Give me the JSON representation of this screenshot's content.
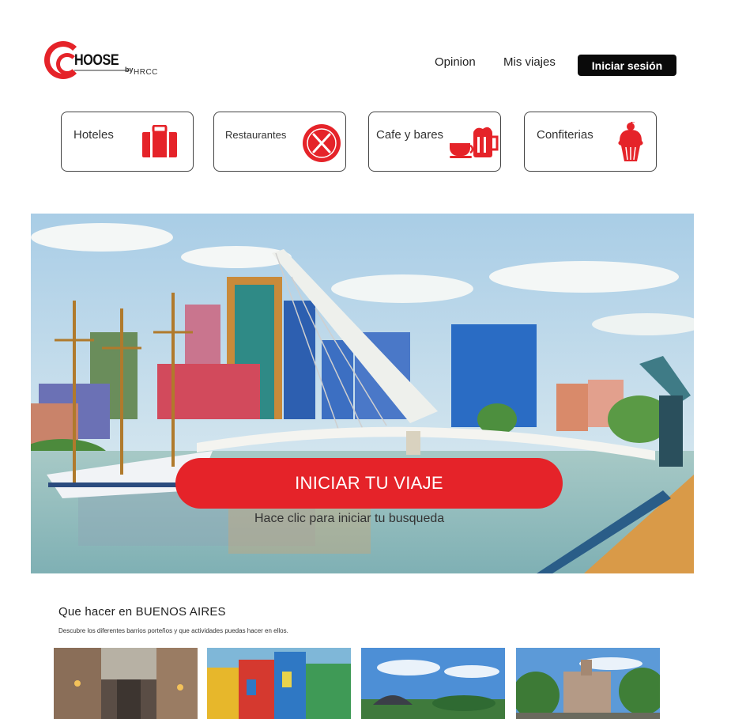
{
  "header": {
    "logo": {
      "brand": "HOOSE",
      "by": "by",
      "group": "HRCC"
    },
    "nav": {
      "opinion": "Opinion",
      "mis_viajes": "Mis viajes"
    },
    "login_label": "Iniciar sesión"
  },
  "categories": [
    {
      "label": "Hoteles",
      "icon": "luggage-icon"
    },
    {
      "label": "Restaurantes",
      "icon": "fork-knife-icon"
    },
    {
      "label": "Cafe y bares",
      "icon": "coffee-beer-icon"
    },
    {
      "label": "Confiterias",
      "icon": "cupcake-icon"
    }
  ],
  "hero": {
    "cta_label": "INICIAR TU VIAJE",
    "cta_subtitle": "Hace clic para iniciar tu busqueda"
  },
  "section": {
    "title": "Que hacer en BUENOS AIRES",
    "description": "Descubre los diferentes barrios porteños y que actividades puedas hacer en ellos."
  },
  "colors": {
    "brand_red": "#e52329",
    "login_bg": "#0a0a0a"
  }
}
